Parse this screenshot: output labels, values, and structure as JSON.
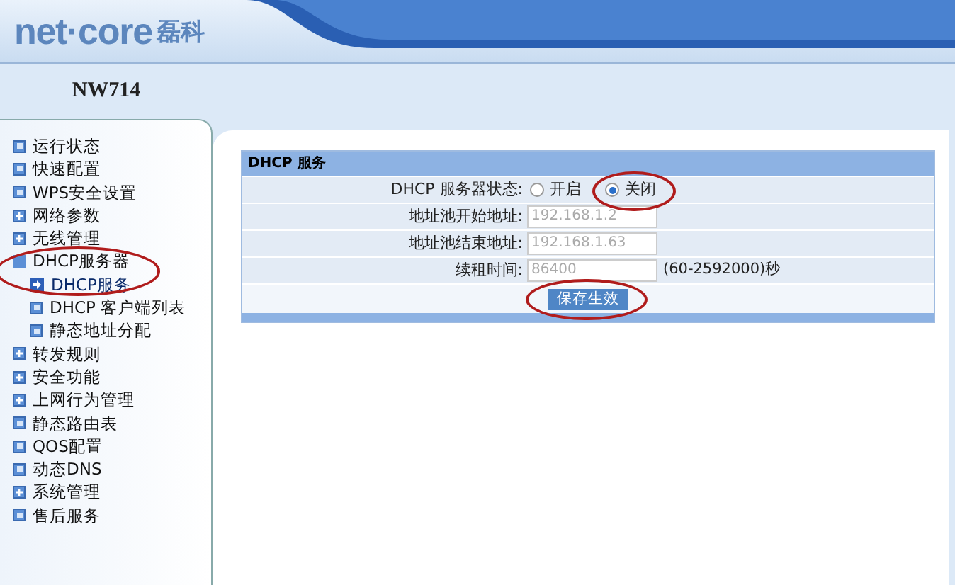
{
  "header": {
    "logo": "net·core",
    "logo_cn": "磊科",
    "model": "NW714"
  },
  "sidebar": {
    "items": [
      {
        "label": "运行状态",
        "kind": "leaf"
      },
      {
        "label": "快速配置",
        "kind": "leaf"
      },
      {
        "label": "WPS安全设置",
        "kind": "leaf"
      },
      {
        "label": "网络参数",
        "kind": "folder"
      },
      {
        "label": "无线管理",
        "kind": "folder"
      },
      {
        "label": "DHCP服务器",
        "kind": "folder",
        "expanded": true,
        "circled": true,
        "children": [
          {
            "label": "DHCP服务",
            "kind": "leaf",
            "selected": true
          },
          {
            "label": "DHCP 客户端列表",
            "kind": "leaf",
            "selected": false
          },
          {
            "label": "静态地址分配",
            "kind": "leaf",
            "selected": false
          }
        ]
      },
      {
        "label": "转发规则",
        "kind": "folder"
      },
      {
        "label": "安全功能",
        "kind": "folder"
      },
      {
        "label": "上网行为管理",
        "kind": "folder"
      },
      {
        "label": "静态路由表",
        "kind": "leaf"
      },
      {
        "label": "QOS配置",
        "kind": "leaf"
      },
      {
        "label": "动态DNS",
        "kind": "leaf"
      },
      {
        "label": "系统管理",
        "kind": "folder"
      },
      {
        "label": "售后服务",
        "kind": "leaf"
      }
    ]
  },
  "panel": {
    "title": "DHCP 服务",
    "rows": [
      {
        "kind": "radio",
        "label": "DHCP 服务器状态:",
        "options": [
          {
            "label": "开启",
            "selected": false,
            "circled": false
          },
          {
            "label": "关闭",
            "selected": true,
            "circled": true
          }
        ]
      },
      {
        "kind": "field",
        "label": "地址池开始地址:",
        "value": "192.168.1.2",
        "disabled": true
      },
      {
        "kind": "field",
        "label": "地址池结束地址:",
        "value": "192.168.1.63",
        "disabled": true
      },
      {
        "kind": "field",
        "label": "续租时间:",
        "value": "86400",
        "disabled": true,
        "hint": "(60-2592000)秒"
      }
    ],
    "save_button": {
      "label": "保存生效",
      "circled": true
    }
  }
}
